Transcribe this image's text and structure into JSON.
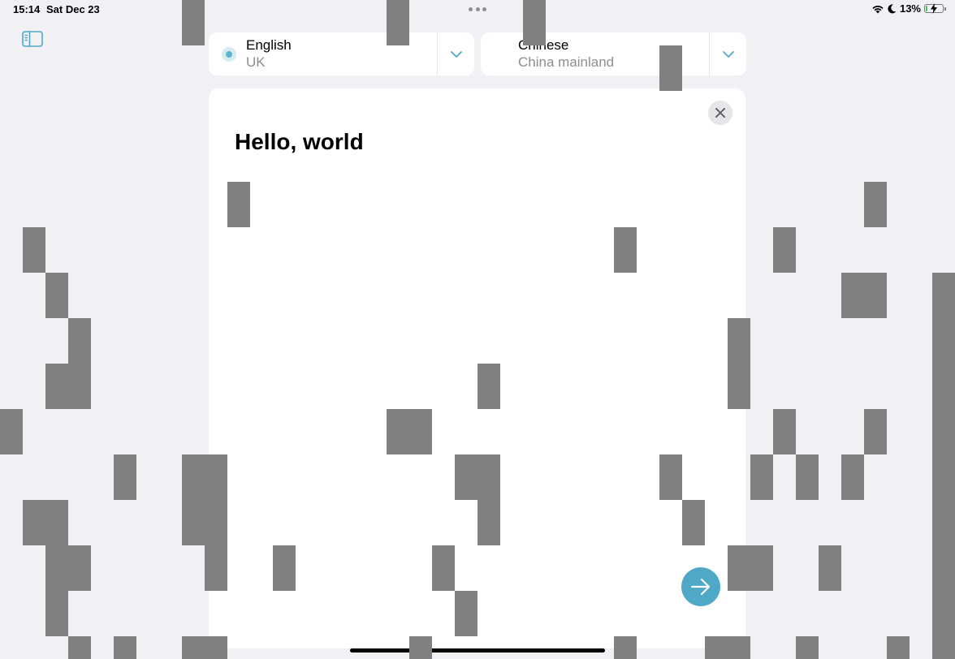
{
  "status_bar": {
    "time": "15:14",
    "date": "Sat Dec 23",
    "battery_percent": "13%",
    "battery_level": 0.13,
    "icons": [
      "wifi-icon",
      "moon-icon",
      "battery-charging-icon"
    ]
  },
  "toolbar": {
    "sidebar_icon": "sidebar-icon"
  },
  "languages": {
    "source": {
      "name": "English",
      "region": "UK"
    },
    "target": {
      "name": "Chinese",
      "region": "China mainland"
    }
  },
  "translation": {
    "input_text": "Hello, world",
    "close_icon": "close-icon",
    "go_icon": "arrow-right-icon"
  },
  "colors": {
    "accent": "#4fa9c6",
    "background": "#f0f0f5",
    "card": "#ffffff",
    "secondary_text": "#8e8e93"
  }
}
